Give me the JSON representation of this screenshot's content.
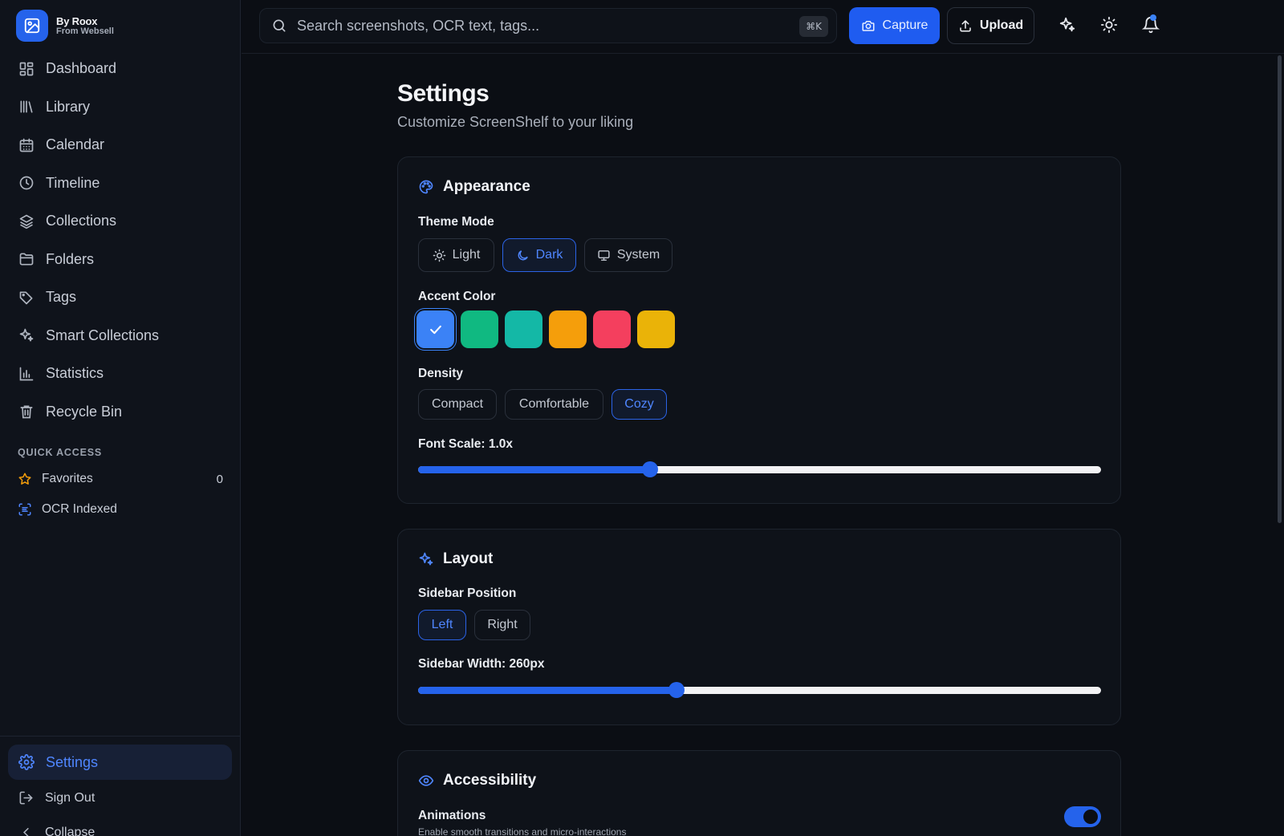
{
  "brand": {
    "title": "By Roox",
    "subtitle": "From Websell"
  },
  "nav": {
    "items": [
      {
        "label": "Dashboard"
      },
      {
        "label": "Library"
      },
      {
        "label": "Calendar"
      },
      {
        "label": "Timeline"
      },
      {
        "label": "Collections"
      },
      {
        "label": "Folders"
      },
      {
        "label": "Tags"
      },
      {
        "label": "Smart Collections"
      },
      {
        "label": "Statistics"
      },
      {
        "label": "Recycle Bin"
      }
    ]
  },
  "quick_access": {
    "label": "QUICK ACCESS",
    "favorites": {
      "label": "Favorites",
      "count": "0"
    },
    "ocr": {
      "label": "OCR Indexed"
    }
  },
  "sidebar_bottom": {
    "settings": "Settings",
    "sign_out": "Sign Out",
    "collapse": "Collapse"
  },
  "topbar": {
    "search_placeholder": "Search screenshots, OCR text, tags...",
    "shortcut": "⌘K",
    "capture": "Capture",
    "upload": "Upload"
  },
  "page": {
    "title": "Settings",
    "subtitle": "Customize ScreenShelf to your liking"
  },
  "appearance": {
    "title": "Appearance",
    "theme_label": "Theme Mode",
    "theme_options": {
      "light": "Light",
      "dark": "Dark",
      "system": "System"
    },
    "theme_selected": "Dark",
    "accent_label": "Accent Color",
    "accent_colors": [
      "#3b82f6",
      "#10b981",
      "#14b8a6",
      "#f59e0b",
      "#f43f5e",
      "#eab308"
    ],
    "accent_selected": "#3b82f6",
    "density_label": "Density",
    "density_options": {
      "compact": "Compact",
      "comfortable": "Comfortable",
      "cozy": "Cozy"
    },
    "density_selected": "Cozy",
    "font_scale_label": "Font Scale: 1.0x",
    "font_scale_fraction": 0.34
  },
  "layout": {
    "title": "Layout",
    "sidebar_position_label": "Sidebar Position",
    "position_options": {
      "left": "Left",
      "right": "Right"
    },
    "position_selected": "Left",
    "sidebar_width_label": "Sidebar Width: 260px",
    "sidebar_width_fraction": 0.378
  },
  "accessibility": {
    "title": "Accessibility",
    "animations_label": "Animations",
    "animations_desc": "Enable smooth transitions and micro-interactions",
    "animations_on": true
  },
  "colors": {
    "accent": "#2563eb",
    "accent_text": "#4f86ff",
    "background": "#0b0e14"
  }
}
